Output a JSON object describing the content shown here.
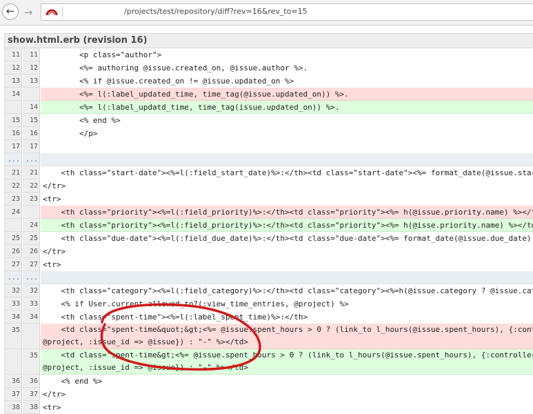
{
  "browser": {
    "back_icon": "arrow-left-icon",
    "forward_icon": "arrow-right-icon",
    "favicon": "redmine-logo-icon",
    "url": "/projects/test/repository/diff?rev=16&rev_to=15"
  },
  "diff": {
    "file_header": "show.html.erb (revision 16)",
    "rows": [
      {
        "type": "ctx",
        "old": "11",
        "new": "11",
        "code": "        <p class=\"author\">"
      },
      {
        "type": "ctx",
        "old": "12",
        "new": "12",
        "code": "        <%= authoring @issue.created_on, @issue.author %>."
      },
      {
        "type": "ctx",
        "old": "13",
        "new": "13",
        "code": "        <% if @issue.created_on != @issue.updated_on %>"
      },
      {
        "type": "del",
        "old": "14",
        "new": "",
        "code": "        <%= l(:label_updated_time, time_tag(@issue.updated_on)) %>."
      },
      {
        "type": "add",
        "old": "",
        "new": "14",
        "code": "        <%= l(:label_updatd_time, time_tag(issue.updated_on)) %>."
      },
      {
        "type": "ctx",
        "old": "15",
        "new": "15",
        "code": "        <% end %>"
      },
      {
        "type": "ctx",
        "old": "16",
        "new": "16",
        "code": "        </p>"
      },
      {
        "type": "ctx",
        "old": "17",
        "new": "17",
        "code": ""
      },
      {
        "type": "sep",
        "old": "...",
        "new": "...",
        "code": ""
      },
      {
        "type": "ctx",
        "old": "21",
        "new": "21",
        "code": "    <th class=\"start-date\"><%=l(:field_start_date)%>:</th><td class=\"start-date\"><%= format_date(@issue.start_date) %></td>"
      },
      {
        "type": "ctx",
        "old": "22",
        "new": "22",
        "code": "</tr>"
      },
      {
        "type": "ctx",
        "old": "23",
        "new": "23",
        "code": "<tr>"
      },
      {
        "type": "del",
        "old": "24",
        "new": "",
        "code": "    <th class=\"priority\"><%=l(:field_priority)%>:</th><td class=\"priority\"><%= h(@issue.priority.name) %></td>"
      },
      {
        "type": "add",
        "old": "",
        "new": "24",
        "code": "    <th class=\"priority\"><%=l(:field_priority)%>:</th><td class=\"priority\"><%= h(@isse.priority.name) %></td>"
      },
      {
        "type": "ctx",
        "old": "25",
        "new": "25",
        "code": "    <th class=\"due-date\"><%=l(:field_due_date)%>:</th><td class=\"due-date\"><%= format_date(@issue.due_date) %></td>"
      },
      {
        "type": "ctx",
        "old": "26",
        "new": "26",
        "code": "</tr>"
      },
      {
        "type": "ctx",
        "old": "27",
        "new": "27",
        "code": "<tr>"
      },
      {
        "type": "sep",
        "old": "...",
        "new": "...",
        "code": ""
      },
      {
        "type": "ctx",
        "old": "32",
        "new": "32",
        "code": "    <th class=\"category\"><%=l(:field_category)%>:</th><td class=\"category\"><%=h(@issue.category ? @issue.category.name : \"-\") %></td>"
      },
      {
        "type": "ctx",
        "old": "33",
        "new": "33",
        "code": "    <% if User.current.allowed_to?(:view_time_entries, @project) %>"
      },
      {
        "type": "ctx",
        "old": "34",
        "new": "34",
        "code": "    <th class=\"spent-time\"><%=l(:label_spent_time)%>:</th>"
      },
      {
        "type": "del",
        "old": "35",
        "new": "",
        "tall": true,
        "code": "    <td class=\"spent-time&quot;&gt;<%= @issue.spent_hours > 0 ? (link_to l_hours(@issue.spent_hours), {:controller => 'timelog', :action => 'details',\n@project, :issue_id => @issue}) : \"-\" %></td>"
      },
      {
        "type": "add",
        "old": "",
        "new": "35",
        "tall": true,
        "code": "    <td class=\"spent-time&gt;<%= @issue.spent_hours > 0 ? (link_to l_hours(@issue.spent_hours), {:controller => 'timelog', :action => 'details',\n@project, :issue_id => @issue}) : \"-\" %></td>"
      },
      {
        "type": "ctx",
        "old": "36",
        "new": "36",
        "code": "    <% end %>"
      },
      {
        "type": "ctx",
        "old": "37",
        "new": "37",
        "code": "</tr>"
      },
      {
        "type": "ctx",
        "old": "38",
        "new": "38",
        "code": "<tr>"
      }
    ]
  },
  "annotation": {
    "shape": "freehand-ellipse",
    "color": "#d11a1a"
  },
  "colors": {
    "deleted": "#ffdddd",
    "added": "#ddffdd",
    "gutter": "#eeeeee",
    "separator": "#e8eef2"
  }
}
